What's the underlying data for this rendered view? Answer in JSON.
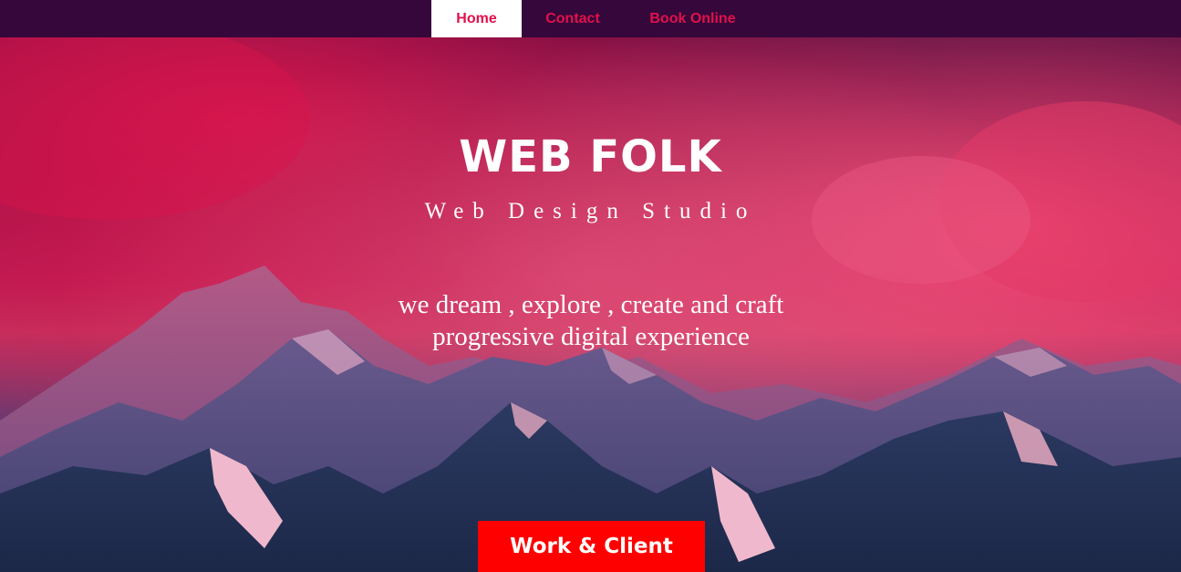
{
  "nav": {
    "items": [
      {
        "label": "Home",
        "active": true
      },
      {
        "label": "Contact",
        "active": false
      },
      {
        "label": "Book Online",
        "active": false
      }
    ]
  },
  "hero": {
    "title": "WEB FOLK",
    "subtitle": "Web Design Studio",
    "tagline_line1": "we dream , explore , create and craft",
    "tagline_line2": "progressive digital experience",
    "cta_label": "Work & Client"
  },
  "colors": {
    "nav_background": "#36073a",
    "nav_text": "#e0104c",
    "nav_active_background": "#ffffff",
    "cta_background": "#ff0000",
    "hero_text": "#ffffff"
  },
  "background_image": "mountains-under-pink-clouds"
}
